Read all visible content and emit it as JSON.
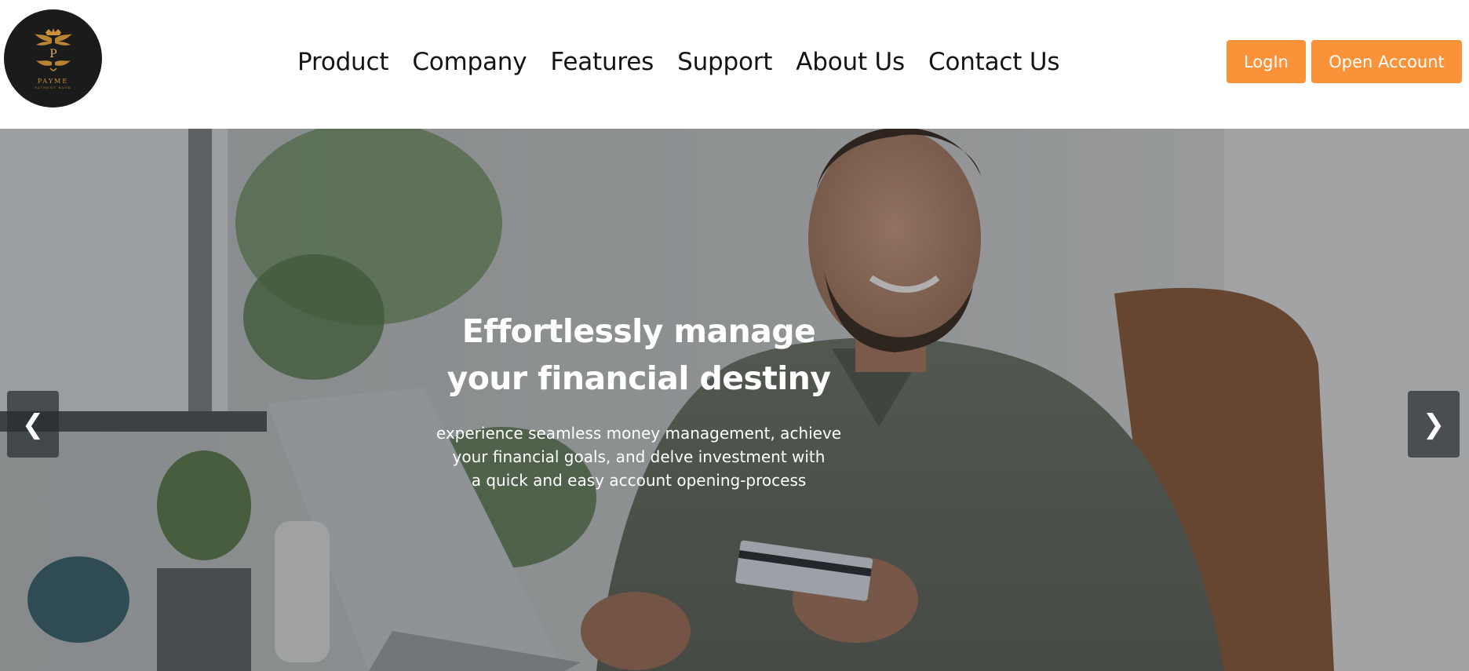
{
  "logo": {
    "icon": "crown-monogram-icon",
    "letter": "P",
    "name": "PAYME",
    "tagline": "PAYMENT BANK",
    "bg_color": "#1b1b1b",
    "accent_color": "#c8913a"
  },
  "nav": {
    "items": [
      {
        "label": "Product"
      },
      {
        "label": "Company"
      },
      {
        "label": "Features"
      },
      {
        "label": "Support"
      },
      {
        "label": "About Us"
      },
      {
        "label": "Contact Us"
      }
    ]
  },
  "auth": {
    "login_label": "LogIn",
    "open_account_label": "Open Account",
    "button_color": "#fa923a"
  },
  "hero": {
    "title_line1": "Effortlessly manage",
    "title_line2": "your financial destiny",
    "subtitle_line1": "experience seamless money management, achieve",
    "subtitle_line2": "your financial goals, and delve investment with",
    "subtitle_line3": "a quick and easy account opening-process",
    "prev_icon": "chevron-left-icon",
    "next_icon": "chevron-right-icon",
    "prev_glyph": "❮",
    "next_glyph": "❯"
  }
}
